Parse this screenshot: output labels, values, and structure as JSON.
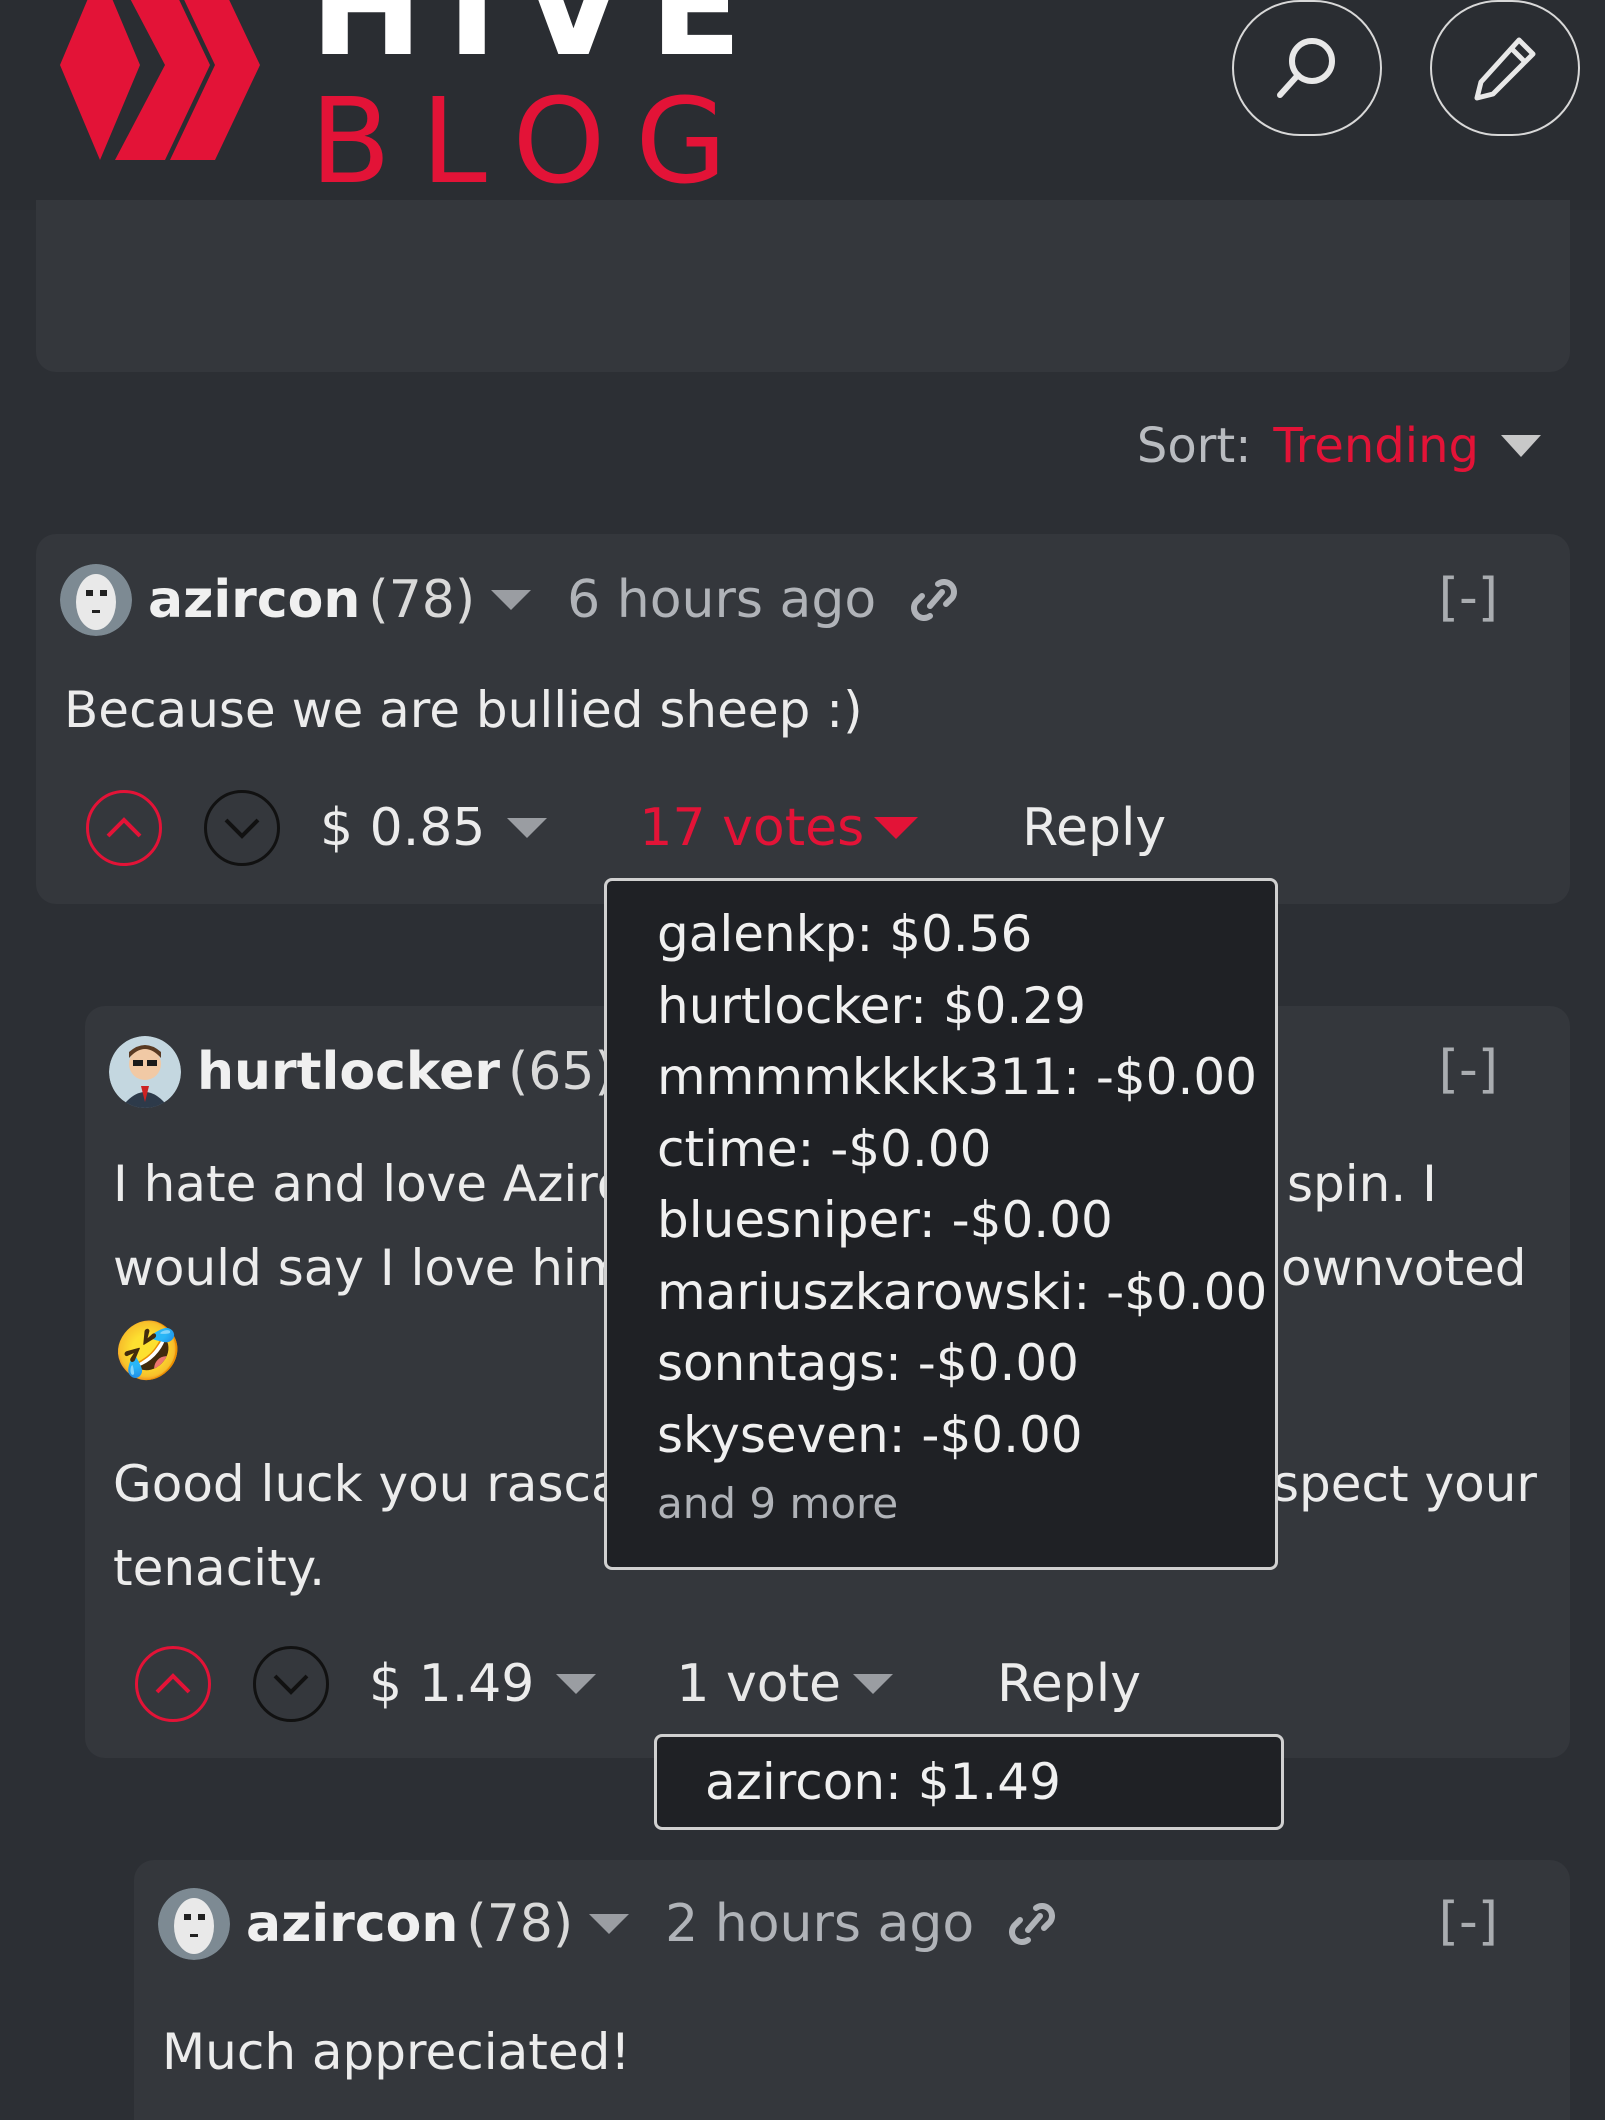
{
  "header": {
    "logo_top": "HIVE",
    "logo_bottom": "BLOG",
    "search_icon": "search-icon",
    "edit_icon": "pencil-icon",
    "brand_color": "#e31337"
  },
  "sort": {
    "label": "Sort:",
    "value": "Trending"
  },
  "comments": [
    {
      "author": "azircon",
      "reputation": "(78)",
      "time": "6 hours ago",
      "collapse": "[-]",
      "body": "Because we are bullied sheep :)",
      "payout": "$ 0.85",
      "votes": "17 votes",
      "reply": "Reply",
      "voters": [
        "galenkp: $0.56",
        "hurtlocker: $0.29",
        "mmmmkkkk311: -$0.00",
        "ctime: -$0.00",
        "bluesniper: -$0.00",
        "mariuszkarowski: -$0.00",
        "sonntags: -$0.00",
        "skyseven: -$0.00"
      ],
      "more": "and 9 more"
    },
    {
      "author": "hurtlocker",
      "reputation": "(65)",
      "collapse": "[-]",
      "body_lines": [
        "I hate and love Azirco",
        "spin. I",
        "would say I love him",
        "ownvoted",
        "🤣",
        "Good luck you rascal.",
        "spect your",
        "tenacity."
      ],
      "payout": "$ 1.49",
      "votes": "1 vote",
      "reply": "Reply",
      "voters": [
        "azircon: $1.49"
      ]
    },
    {
      "author": "azircon",
      "reputation": "(78)",
      "time": "2 hours ago",
      "collapse": "[-]",
      "body": "Much appreciated!"
    }
  ]
}
